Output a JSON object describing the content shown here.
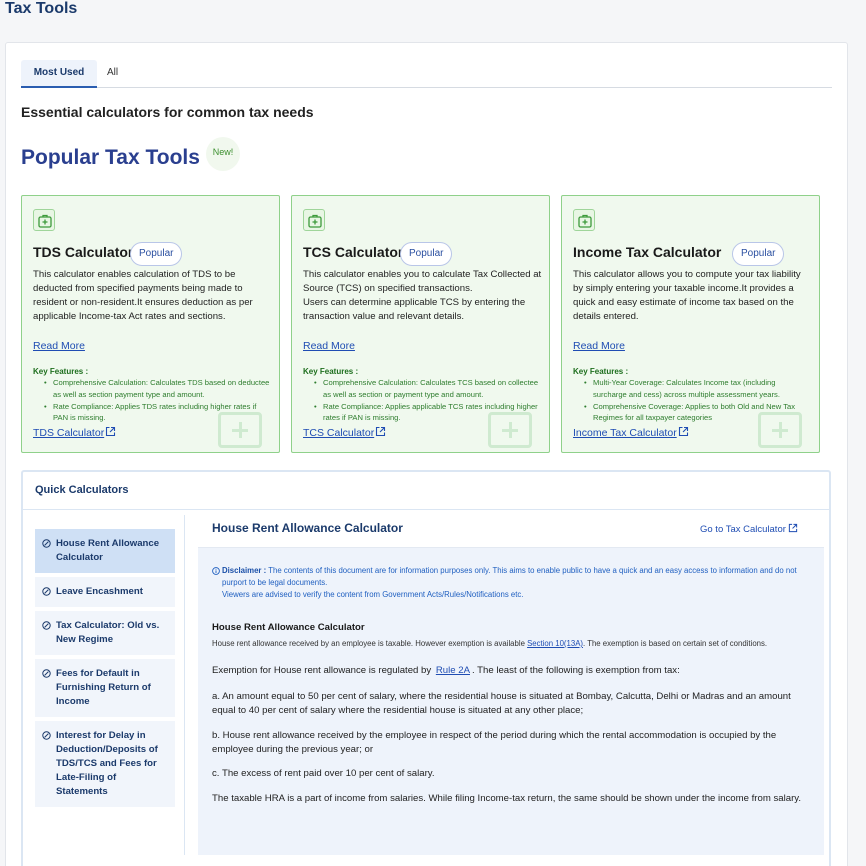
{
  "page_title": "Tax Tools",
  "tabs": [
    {
      "label": "Most Used",
      "active": true
    },
    {
      "label": "All",
      "active": false
    }
  ],
  "subtitle": "Essential calculators for common tax needs",
  "popular": {
    "title": "Popular Tax Tools",
    "new_badge": "New!"
  },
  "colors": {
    "brand": "#1b3a6b",
    "card_bg": "#f0f9ee",
    "card_border": "#8fd18a",
    "link": "#1f4db3",
    "key_feature_text": "#2e7d2e"
  },
  "cards": [
    {
      "icon": "medical-bag-icon",
      "title": "TDS Calculator",
      "badge": "Popular",
      "description": "This calculator enables calculation of TDS to be deducted from specified payments being made to resident or non-resident.It ensures deduction as per applicable Income-tax Act rates and sections.",
      "read_more": "Read More",
      "key_features_title": "Key Features :",
      "features": [
        "Comprehensive Calculation: Calculates TDS based on deductee as well as section payment type and amount.",
        "Rate Compliance: Applies TDS rates including higher rates if PAN is missing."
      ],
      "link_label": "TDS Calculator"
    },
    {
      "icon": "medical-bag-icon",
      "title": "TCS Calculator",
      "badge": "Popular",
      "description": "This calculator enables you to calculate Tax Collected at Source (TCS) on specified transactions.\nUsers can determine applicable TCS by entering the transaction value and relevant details.",
      "read_more": "Read More",
      "key_features_title": "Key Features :",
      "features": [
        "Comprehensive Calculation: Calculates TCS based on collectee as well as section or payment type and amount.",
        "Rate Compliance: Applies applicable TCS rates including higher rates if PAN is missing."
      ],
      "link_label": "TCS Calculator"
    },
    {
      "icon": "medical-bag-icon",
      "title": "Income Tax Calculator",
      "badge": "Popular",
      "description": "This calculator allows you to compute your tax liability by simply entering your taxable income.It provides a quick and easy estimate of income tax based on the details entered.",
      "read_more": "Read More",
      "key_features_title": "Key Features :",
      "features": [
        "Multi-Year Coverage: Calculates Income tax (including surcharge and cess) across multiple assessment years.",
        "Comprehensive Coverage: Applies to both Old and New Tax Regimes for all taxpayer categories"
      ],
      "link_label": "Income Tax Calculator"
    }
  ],
  "quick": {
    "title": "Quick Calculators",
    "items": [
      {
        "label": "House Rent Allowance Calculator",
        "active": true
      },
      {
        "label": "Leave Encashment",
        "active": false
      },
      {
        "label": "Tax Calculator: Old vs. New Regime",
        "active": false
      },
      {
        "label": "Fees for Default in Furnishing Return of Income",
        "active": false
      },
      {
        "label": "Interest for Delay in Deduction/Deposits of TDS/TCS and Fees for Late-Filing of Statements",
        "active": false
      }
    ]
  },
  "hra": {
    "title": "House Rent Allowance Calculator",
    "go_link": "Go to Tax Calculator",
    "disclaimer_label": "Disclaimer :",
    "disclaimer_text": "The contents of this document are for information purposes only. This aims to enable public to have a quick and an easy access to information and do not purport to be legal documents.",
    "disclaimer_text2": "Viewers are advised to verify the content from Government Acts/Rules/Notifications etc.",
    "section_title": "House Rent Allowance Calculator",
    "intro_before": "House rent allowance received by an employee is taxable. However exemption is available ",
    "intro_link": "Section 10(13A)",
    "intro_after": ". The exemption is based on certain set of conditions.",
    "exemption_before": "Exemption for House rent allowance is regulated by ",
    "exemption_link": "Rule 2A",
    "exemption_after": ". The least of the following is exemption from tax:",
    "point_a": "a. An amount equal to 50 per cent of salary, where the residential house is situated at Bombay, Calcutta, Delhi or Madras and an amount equal to 40 per cent of salary where the residential house is situated at any other place;",
    "point_b": "b. House rent allowance received by the employee in respect of the period during which the rental accommodation is occupied by the employee during the previous year; or",
    "point_c": "c. The excess of rent paid over 10 per cent of salary.",
    "taxable_note": "The taxable HRA is a part of income from salaries. While filing Income-tax return, the same should be shown under the income from salary."
  }
}
